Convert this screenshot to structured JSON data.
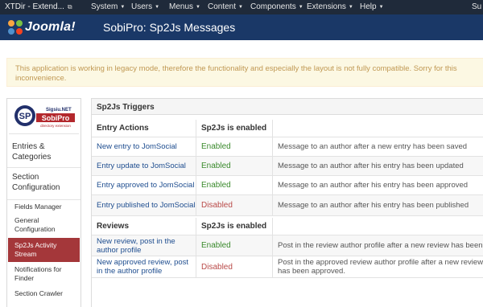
{
  "navbar": {
    "site": "XTDir - Extend...",
    "site_icon": "external-link-icon",
    "menus": [
      "System",
      "Users",
      "Menus",
      "Content",
      "Components",
      "Extensions",
      "Help"
    ],
    "right_label": "Su",
    "background": "#1f2a3a"
  },
  "header": {
    "logo_text": "Joomla!",
    "page_title": "SobiPro: Sp2Js Messages",
    "background": "#1a3867"
  },
  "notice": {
    "text": "This application is working in legacy mode, therefore the functionality and especially the layout is not fully compatible. Sorry for this inconvenience."
  },
  "sidebar": {
    "logo": {
      "tagline": "Sigsiu.NET",
      "name": "SobiPro",
      "sub": "directory extension"
    },
    "groups": [
      "Entries & Categories",
      "Section Configuration"
    ],
    "items": [
      "Fields Manager",
      "General Configuration",
      "Sp2Js Activity Stream",
      "Notifications for Finder",
      "Section Crawler"
    ],
    "active_item": "Sp2Js Activity Stream"
  },
  "panel": {
    "title": "Sp2Js Triggers",
    "entry_header": {
      "col1": "Entry Actions",
      "col2": "Sp2Js is enabled"
    },
    "entry_rows": [
      {
        "action": "New entry to JomSocial",
        "status": "Enabled",
        "message": "Message to an author after a new entry has been saved"
      },
      {
        "action": "Entry update to JomSocial",
        "status": "Enabled",
        "message": "Message to an author after his entry has been updated"
      },
      {
        "action": "Entry approved to JomSocial",
        "status": "Enabled",
        "message": "Message to an author after his entry has been approved"
      },
      {
        "action": "Entry published to JomSocial",
        "status": "Disabled",
        "message": "Message to an author after his entry has been published"
      }
    ],
    "review_header": {
      "col1": "Reviews",
      "col2": "Sp2Js is enabled"
    },
    "review_rows": [
      {
        "action": "New review, post in the author profile",
        "status": "Enabled",
        "message": "Post in the review author profile after a new review has been"
      },
      {
        "action": "New approved review, post in the author profile",
        "status": "Disabled",
        "message": "Post in the approved review author profile after a new review has been approved."
      }
    ]
  },
  "colors": {
    "enabled": "#3a8a2c",
    "disabled": "#b94a48",
    "active_item": "#a4373a"
  }
}
